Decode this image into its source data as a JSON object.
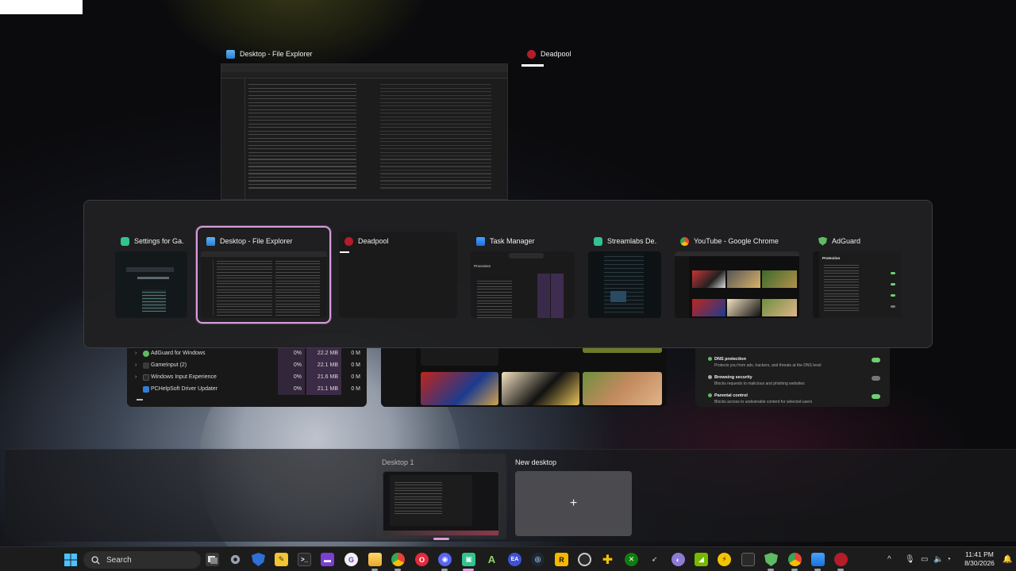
{
  "background_windows": {
    "file_explorer": {
      "title": "Desktop - File Explorer",
      "icon": "folder-icon"
    },
    "deadpool": {
      "title": "Deadpool",
      "icon": "deadpool-icon"
    }
  },
  "back_previews": {
    "task_manager_rows": [
      {
        "name": "AdGuard for Windows",
        "cpu": "0%",
        "memory": "22.2 MB",
        "disk": "0 M",
        "expandable": true
      },
      {
        "name": "GameInput (2)",
        "cpu": "0%",
        "memory": "22.1 MB",
        "disk": "0 M",
        "expandable": true
      },
      {
        "name": "Windows Input Experience",
        "cpu": "0%",
        "memory": "21.6 MB",
        "disk": "0 M",
        "expandable": true
      },
      {
        "name": "PCHelpSoft Driver Updater",
        "cpu": "0%",
        "memory": "21.1 MB",
        "disk": "0 M",
        "expandable": false
      }
    ],
    "adguard_items": [
      {
        "title": "DNS protection",
        "desc": "Protects you from ads, trackers, and threats at the DNS level",
        "on": true
      },
      {
        "title": "Browsing security",
        "desc": "Blocks requests to malicious and phishing websites",
        "on": false
      },
      {
        "title": "Parental control",
        "desc": "Blocks access to undesirable content for selected users",
        "on": true
      }
    ]
  },
  "switcher": {
    "cards": [
      {
        "title": "Settings for Ga...",
        "icon": "streamlabs-icon",
        "selected": false
      },
      {
        "title": "Desktop - File Explorer",
        "icon": "folder-icon",
        "selected": true
      },
      {
        "title": "Deadpool",
        "icon": "deadpool-icon",
        "selected": false
      },
      {
        "title": "Task Manager",
        "icon": "task-manager-icon",
        "selected": false
      },
      {
        "title": "Streamlabs De...",
        "icon": "streamlabs-icon",
        "selected": false
      },
      {
        "title": "YouTube - Google Chrome",
        "icon": "chrome-icon",
        "selected": false
      },
      {
        "title": "AdGuard",
        "icon": "adguard-icon",
        "selected": false
      }
    ],
    "adguard_preview_heading": "Protection",
    "tm_preview_heading": "Processes"
  },
  "desktops": {
    "current": "Desktop 1",
    "new_label": "New desktop",
    "new_symbol": "+"
  },
  "taskbar": {
    "search_placeholder": "Search",
    "apps": [
      "windows-start-icon",
      "task-view-icon",
      "settings-icon",
      "defender-icon",
      "notepad-icon",
      "terminal-icon",
      "twitch-icon",
      "github-desktop-icon",
      "file-explorer-icon",
      "chrome-icon",
      "opera-icon",
      "discord-icon",
      "streamlabs-icon",
      "nvim-icon",
      "ea-icon",
      "steam-icon",
      "rockstar-icon",
      "obs-icon",
      "plus-icon",
      "xbox-icon",
      "rocket-icon",
      "proton-icon",
      "nvidia-icon",
      "bolt-icon",
      "adguard-icon",
      "chrome-icon",
      "task-manager-icon",
      "deadpool-icon"
    ],
    "tray": {
      "chevron": "^",
      "time": "11:41 PM",
      "date": "8/30/2026"
    }
  },
  "colors": {
    "selection": "#d79bdc",
    "taskbar": "#1c1c1c",
    "switcher_bg": "#202022"
  }
}
